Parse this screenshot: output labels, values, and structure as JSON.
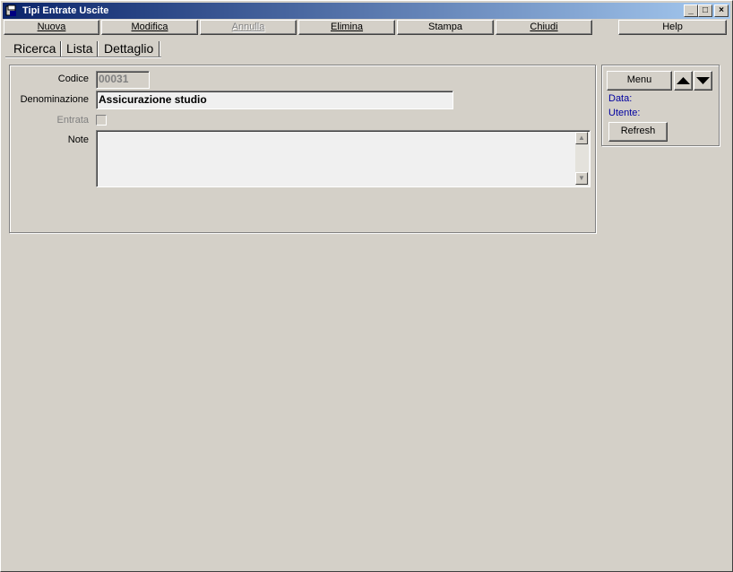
{
  "window": {
    "title": "Tipi Entrate Uscite",
    "icon": "app-icon",
    "controls": [
      "minimize-icon",
      "maximize-icon",
      "close-icon"
    ]
  },
  "toolbar": {
    "nuova": "Nuova",
    "modifica": "Modifica",
    "annulla": "Annulla",
    "elimina": "Elimina",
    "stampa": "Stampa",
    "chiudi": "Chiudi",
    "help": "Help"
  },
  "tabs": {
    "ricerca": "Ricerca",
    "lista": "Lista",
    "dettaglio": "Dettaglio"
  },
  "form": {
    "codice_label": "Codice",
    "codice_value": "00031",
    "denominazione_label": "Denominazione",
    "denominazione_value": "Assicurazione studio",
    "entrata_label": "Entrata",
    "note_label": "Note",
    "note_value": ""
  },
  "side_panel": {
    "menu_label": "Menu",
    "data_label": "Data:",
    "utente_label": "Utente:",
    "refresh_label": "Refresh"
  },
  "colors": {
    "titlebar_start": "#0a246a",
    "titlebar_end": "#a6caf0",
    "face": "#d4d0c8",
    "info_text": "#0000a0"
  }
}
